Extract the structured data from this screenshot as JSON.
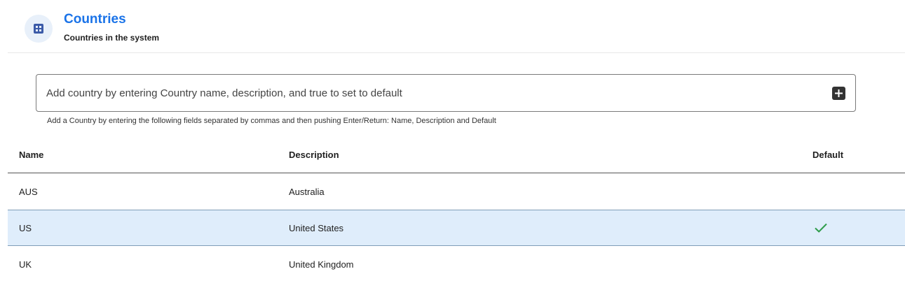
{
  "header": {
    "icon": "grid-icon",
    "title": "Countries",
    "subtitle": "Countries in the system"
  },
  "add_country": {
    "placeholder": "Add country by entering Country name, description, and true to set to default",
    "value": "",
    "button_icon": "add-box-icon",
    "helper_text": "Add a Country by entering the following fields separated by commas and then pushing Enter/Return: Name, Description and Default"
  },
  "table": {
    "columns": {
      "name": "Name",
      "description": "Description",
      "default": "Default"
    },
    "rows": [
      {
        "name": "AUS",
        "description": "Australia",
        "default": false
      },
      {
        "name": "US",
        "description": "United States",
        "default": true
      },
      {
        "name": "UK",
        "description": "United Kingdom",
        "default": false
      }
    ],
    "selected_row": 1
  },
  "colors": {
    "accent": "#1a73e8",
    "icon_blue": "#3b5aa8",
    "selected_row_bg": "#dfedfb",
    "check_green": "#2e9c4a"
  }
}
